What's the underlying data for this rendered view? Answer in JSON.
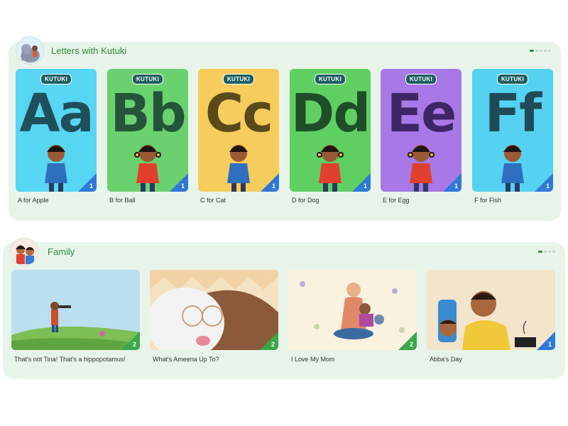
{
  "letters_shelf": {
    "title": "Letters with Kutuki",
    "avatar_icon": "elephant-kids-icon",
    "cards": [
      {
        "letters": "Aa",
        "label": "A for Apple",
        "bg": "#57d6f4",
        "ink": "#1f4f5a",
        "count": "1",
        "kid": "boy"
      },
      {
        "letters": "Bb",
        "label": "B for Ball",
        "bg": "#6ad16f",
        "ink": "#24553a",
        "count": "1",
        "kid": "girl"
      },
      {
        "letters": "Cc",
        "label": "C for Cat",
        "bg": "#f6cd5c",
        "ink": "#5a4a1a",
        "count": "1",
        "kid": "boy"
      },
      {
        "letters": "Dd",
        "label": "D for Dog",
        "bg": "#5fcf62",
        "ink": "#1f4d2a",
        "count": "1",
        "kid": "girl"
      },
      {
        "letters": "Ee",
        "label": "E for Egg",
        "bg": "#a878e6",
        "ink": "#3d2566",
        "count": "1",
        "kid": "girl"
      },
      {
        "letters": "Ff",
        "label": "F for Fish",
        "bg": "#55d2f2",
        "ink": "#1f4a58",
        "count": "1",
        "kid": "boy"
      }
    ],
    "badge": "KUTUKI"
  },
  "family_shelf": {
    "title": "Family",
    "avatar_icon": "family-icon",
    "cards": [
      {
        "label": "That's not Tina! That's a hippopotamus!",
        "count": "2",
        "corner_color": "#3aa848"
      },
      {
        "label": "What's Ameena Up To?",
        "count": "2",
        "corner_color": "#3aa848"
      },
      {
        "label": "I Love My Mom",
        "count": "2",
        "corner_color": "#3aa848"
      },
      {
        "label": "Abba's Day",
        "count": "1",
        "corner_color": "#2f78d8"
      }
    ]
  },
  "colors": {
    "shelf_bg": "#e8f3e9",
    "accent_green": "#2e8a3e",
    "corner_blue": "#2f78d8"
  }
}
